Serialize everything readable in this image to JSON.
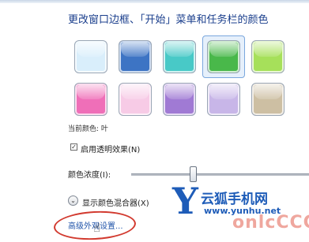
{
  "title": "更改窗口边框、「开始」菜单和任务栏的颜色",
  "swatches": [
    {
      "name": "sky",
      "color": "#d9eefb",
      "selected": false
    },
    {
      "name": "twilight",
      "color": "#3d74c4",
      "selected": false
    },
    {
      "name": "sea",
      "color": "#48c9c7",
      "selected": false
    },
    {
      "name": "leaf",
      "color": "#49b84a",
      "selected": true
    },
    {
      "name": "lime",
      "color": "#a6e05a",
      "selected": false
    },
    {
      "name": "fuchsia",
      "color": "#ef6fb8",
      "selected": false
    },
    {
      "name": "blush",
      "color": "#f7cbe6",
      "selected": false
    },
    {
      "name": "violet",
      "color": "#a07ad4",
      "selected": false
    },
    {
      "name": "lavender",
      "color": "#c8b6e8",
      "selected": false
    },
    {
      "name": "taupe",
      "color": "#cdbfa3",
      "selected": false
    }
  ],
  "current_color": {
    "label": "当前颜色: 叶"
  },
  "transparency": {
    "label": "启用透明效果(N)",
    "checked": true
  },
  "intensity": {
    "label": "颜色浓度(I):",
    "value_percent": 35
  },
  "mixer": {
    "label": "显示颜色混合器(X)"
  },
  "advanced_link": "高级外观设置...",
  "watermark": {
    "cn": "云狐手机网",
    "url": "www.yunhu.net",
    "red": "onlcCCC"
  },
  "colors": {
    "link": "#2255aa",
    "annotation_circle": "#d23a2f",
    "watermark": "#1e5cb8"
  }
}
